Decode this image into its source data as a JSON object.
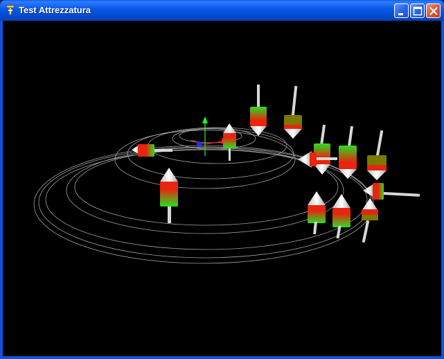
{
  "window": {
    "title": "Test Attrezzatura",
    "app_icon": "tool-icon",
    "controls": [
      "minimize-icon",
      "maximize-icon",
      "close-icon"
    ]
  },
  "scene": {
    "background": "#000000",
    "track_color": "#d9d9d9",
    "tool_colors": {
      "green": "#27e021",
      "red": "#e8250f",
      "cone": "#e6e6e6"
    },
    "axis_colors": {
      "x": "#ff1e1e",
      "y": "#1eff1e",
      "z": "#1e1eff"
    }
  }
}
